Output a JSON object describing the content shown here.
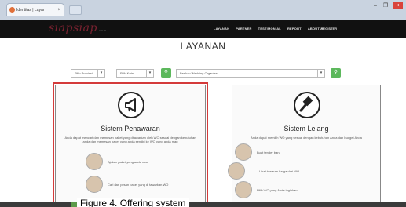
{
  "browser": {
    "tab_title": "Identitas | Layar",
    "tab_close": "×",
    "min": "–",
    "max": "❐",
    "close": "×"
  },
  "site": {
    "logo": "siapsiap",
    "logo_sub": "com",
    "nav": [
      "LAYANAN",
      "PARTNER",
      "TESTIMONIAL",
      "REPORT",
      "ABOUTUS"
    ],
    "nav_right": "REGISTER"
  },
  "page": {
    "title": "LAYANAN"
  },
  "filters": {
    "province": "Pilih Provinsi",
    "city": "Pilih Kota",
    "search_placeholder": "Berikan Wedding Organizer",
    "caret": "▾",
    "search_icon": "search-icon"
  },
  "cards": [
    {
      "title": "Sistem Penawaran",
      "icon": "megaphone-icon",
      "desc": "Anda dapat mencari dan memesan paket yang ditawarkan oleh WO sesuai dengan kebutuhan anda dan memesan paket yang anda sendiri ke WO yang anda mau",
      "steps": [
        "Ajukan paket yang anda mau",
        "Cari dan pesan paket yang di tawarkan WO"
      ]
    },
    {
      "title": "Sistem Lelang",
      "icon": "gavel-icon",
      "desc": "Anda dapat memilih WO yang sesuai dengan kebutuhan Anda dan budget Anda",
      "steps": [
        "Buat tender baru",
        "Lihat tawaran harga dari WO",
        "Pilih WO yang Anda inginkan"
      ]
    }
  ],
  "caption": "Figure 4. Offering system"
}
